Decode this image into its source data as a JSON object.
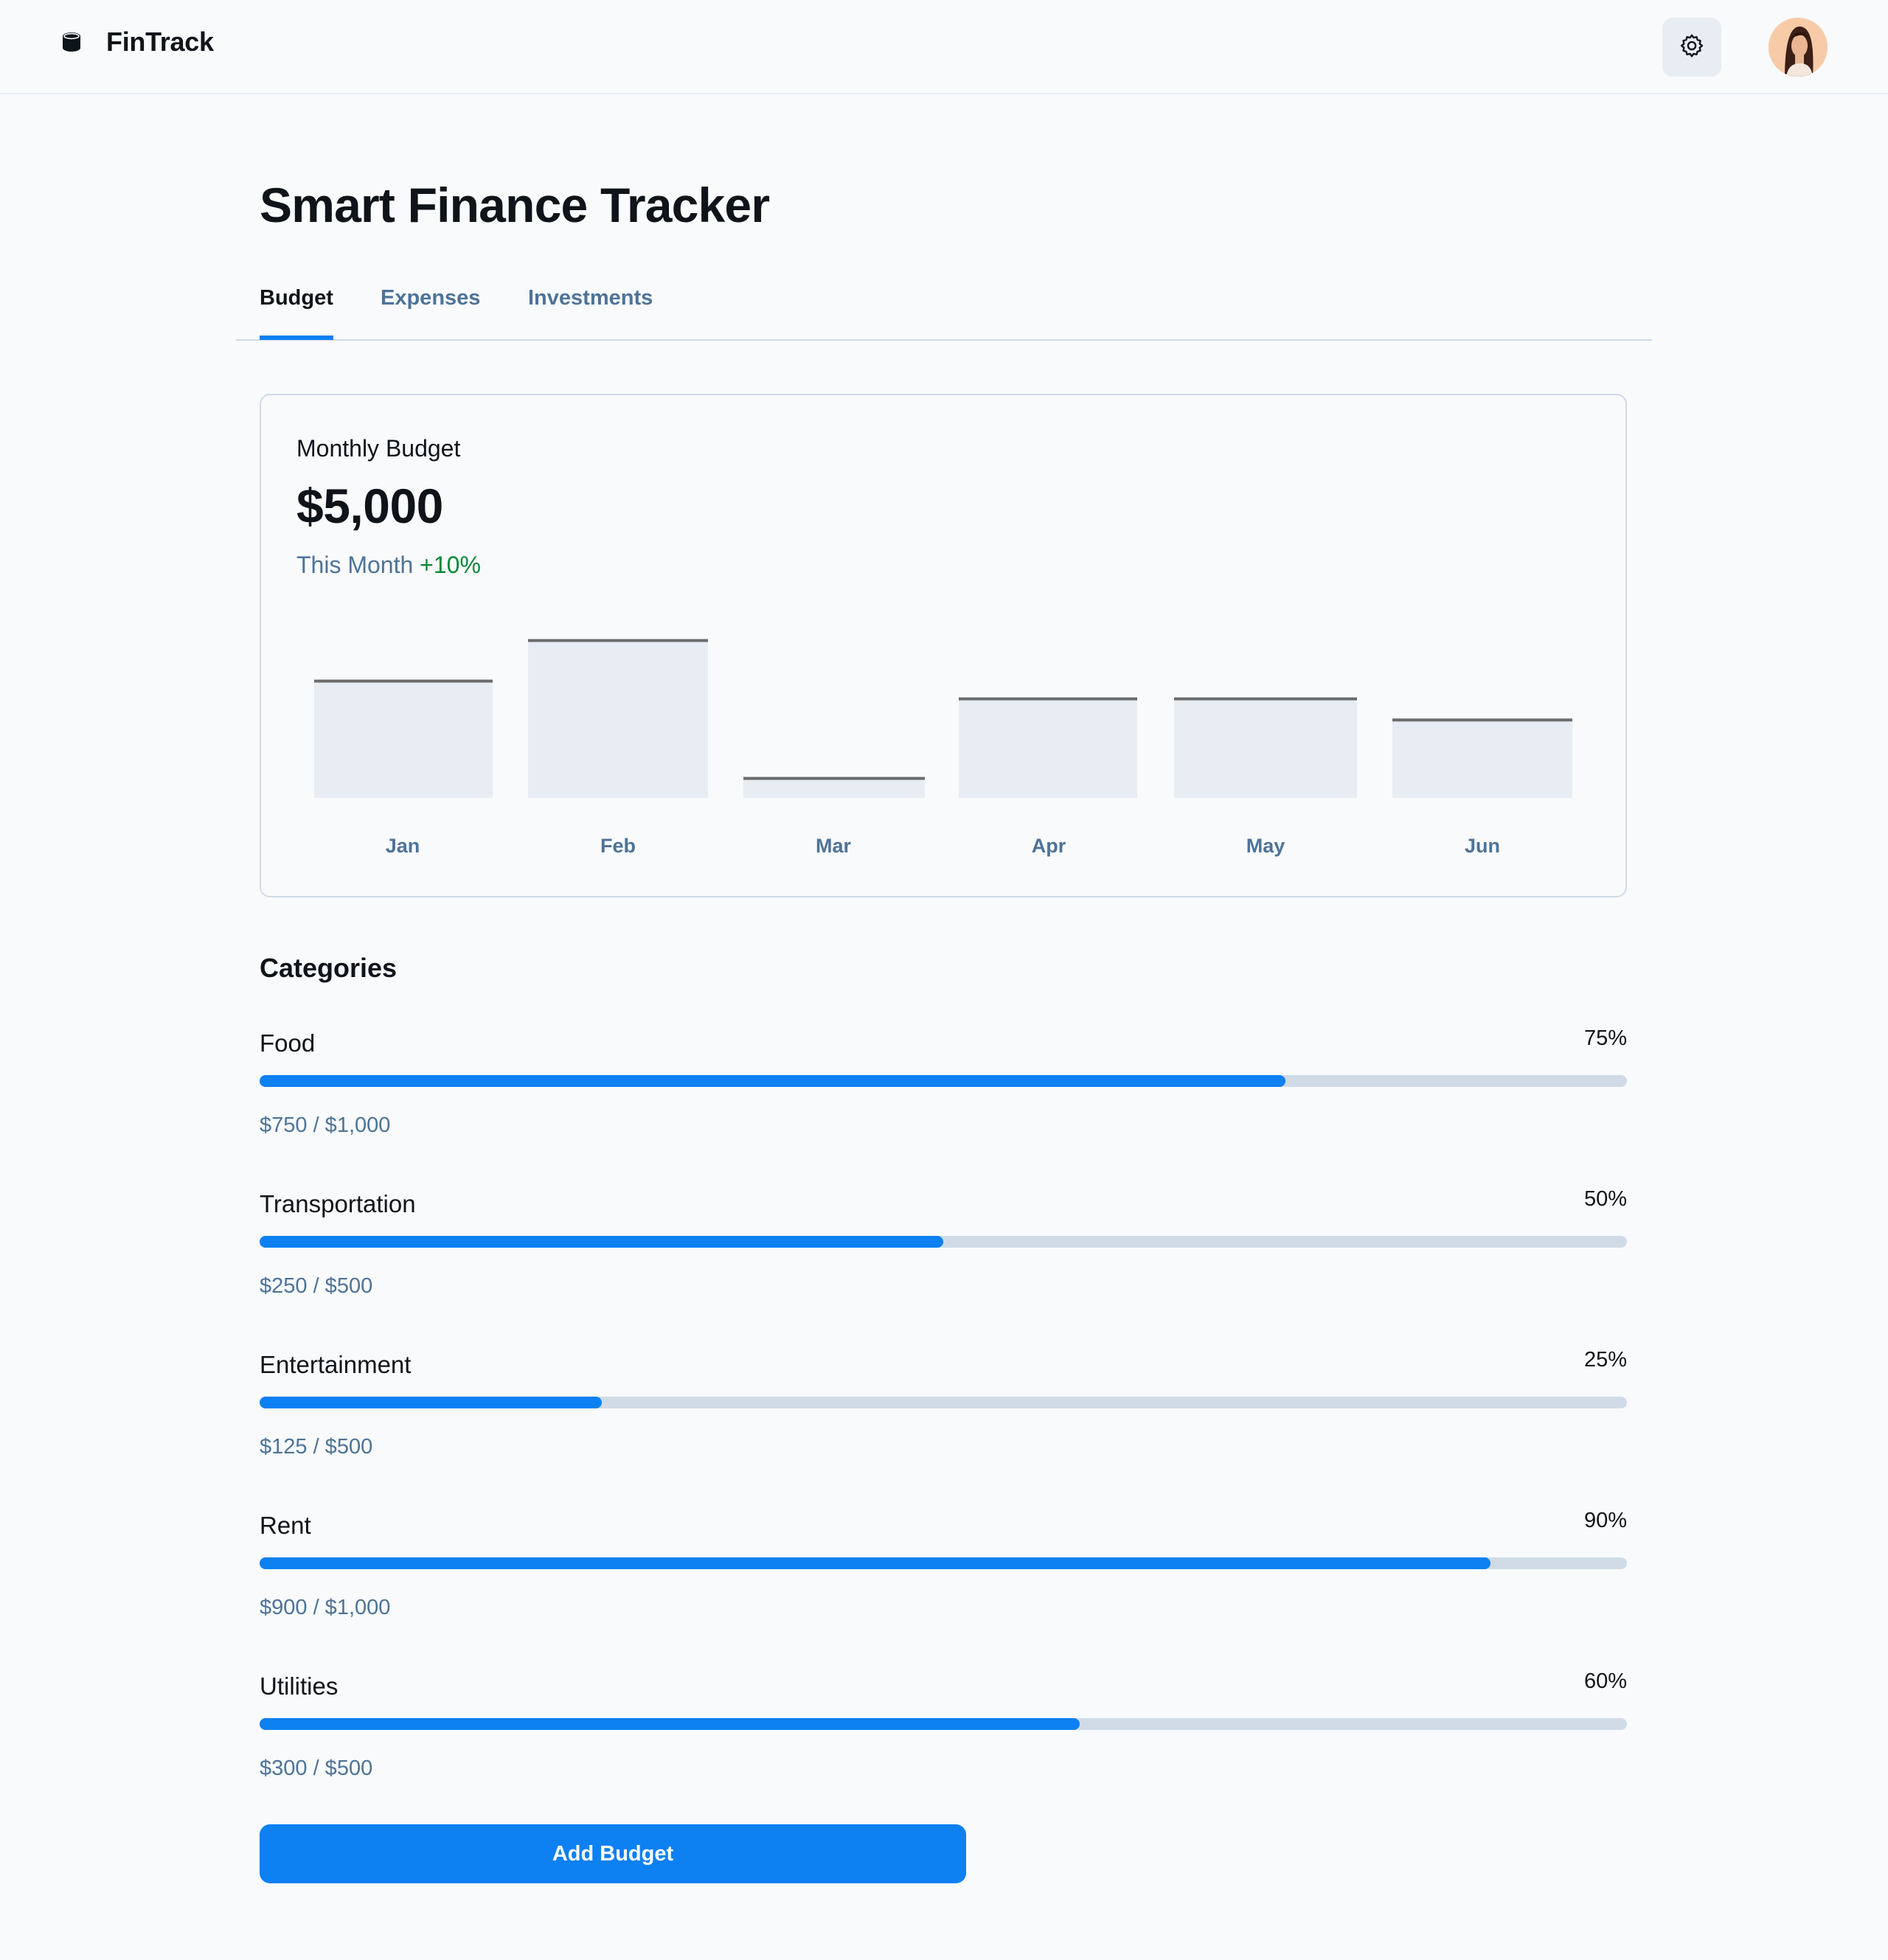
{
  "header": {
    "brand": "FinTrack",
    "brand_icon": "coin-stack-icon",
    "settings_icon": "gear-icon",
    "avatar_icon": "user-avatar"
  },
  "page": {
    "title": "Smart Finance Tracker"
  },
  "tabs": [
    {
      "label": "Budget",
      "active": true
    },
    {
      "label": "Expenses",
      "active": false
    },
    {
      "label": "Investments",
      "active": false
    }
  ],
  "budget_card": {
    "label": "Monthly Budget",
    "value": "$5,000",
    "period": "This Month",
    "trend": "+10%"
  },
  "chart_data": {
    "type": "bar",
    "categories": [
      "Jan",
      "Feb",
      "Mar",
      "Apr",
      "May",
      "Jun"
    ],
    "values": [
      72,
      97,
      12,
      61,
      61,
      48
    ],
    "ylim": [
      0,
      100
    ]
  },
  "categories_section": {
    "title": "Categories",
    "items": [
      {
        "name": "Food",
        "percent_label": "75%",
        "percent": 75,
        "amount": "$750 / $1,000"
      },
      {
        "name": "Transportation",
        "percent_label": "50%",
        "percent": 50,
        "amount": "$250 / $500"
      },
      {
        "name": "Entertainment",
        "percent_label": "25%",
        "percent": 25,
        "amount": "$125 / $500"
      },
      {
        "name": "Rent",
        "percent_label": "90%",
        "percent": 90,
        "amount": "$900 / $1,000"
      },
      {
        "name": "Utilities",
        "percent_label": "60%",
        "percent": 60,
        "amount": "$300 / $500"
      }
    ]
  },
  "actions": {
    "add_budget_label": "Add Budget"
  },
  "colors": {
    "accent": "#0d80f2",
    "muted_text": "#4e7397",
    "positive": "#078838",
    "bar_fill": "#e7edf3",
    "bar_top": "#6b6b6b",
    "track": "#d0dbe7"
  }
}
